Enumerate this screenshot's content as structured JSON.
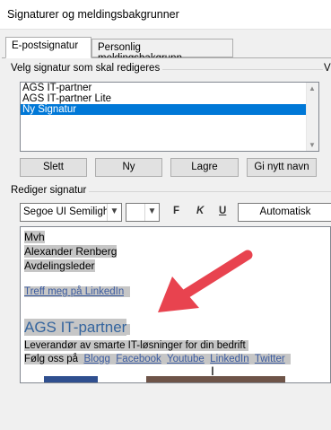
{
  "window": {
    "title": "Signaturer og meldingsbakgrunner"
  },
  "tabs": [
    {
      "label": "E-postsignatur",
      "active": true
    },
    {
      "label": "Personlig meldingsbakgrunn",
      "active": false
    }
  ],
  "select_group": {
    "label": "Velg signatur som skal redigeres",
    "right_label": "V",
    "items": [
      "AGS IT-partner",
      "AGS IT-partner Lite",
      "Ny Signatur"
    ],
    "selected": "Ny Signatur"
  },
  "buttons": {
    "delete": "Slett",
    "new": "Ny",
    "save": "Lagre",
    "rename": "Gi nytt navn"
  },
  "edit_group": {
    "label": "Rediger signatur",
    "font_name": "Segoe UI Semiligh",
    "font_size": "",
    "bold": "F",
    "italic": "K",
    "underline": "U",
    "color": "Automatisk"
  },
  "signature": {
    "greeting": "Mvh",
    "name": "Alexander Renberg",
    "role": "Avdelingsleder",
    "linkedin_link": "Treff meg på LinkedIn",
    "company": "AGS IT-partner",
    "tagline": "Leverandør av smarte IT-løsninger for din bedrift",
    "follow_text": "Følg oss på",
    "social_links": [
      "Blogg",
      "Facebook",
      "Youtube",
      "LinkedIn",
      "Twitter"
    ]
  },
  "annotation": {
    "color": "#e8434f",
    "icon": "arrow-icon"
  }
}
